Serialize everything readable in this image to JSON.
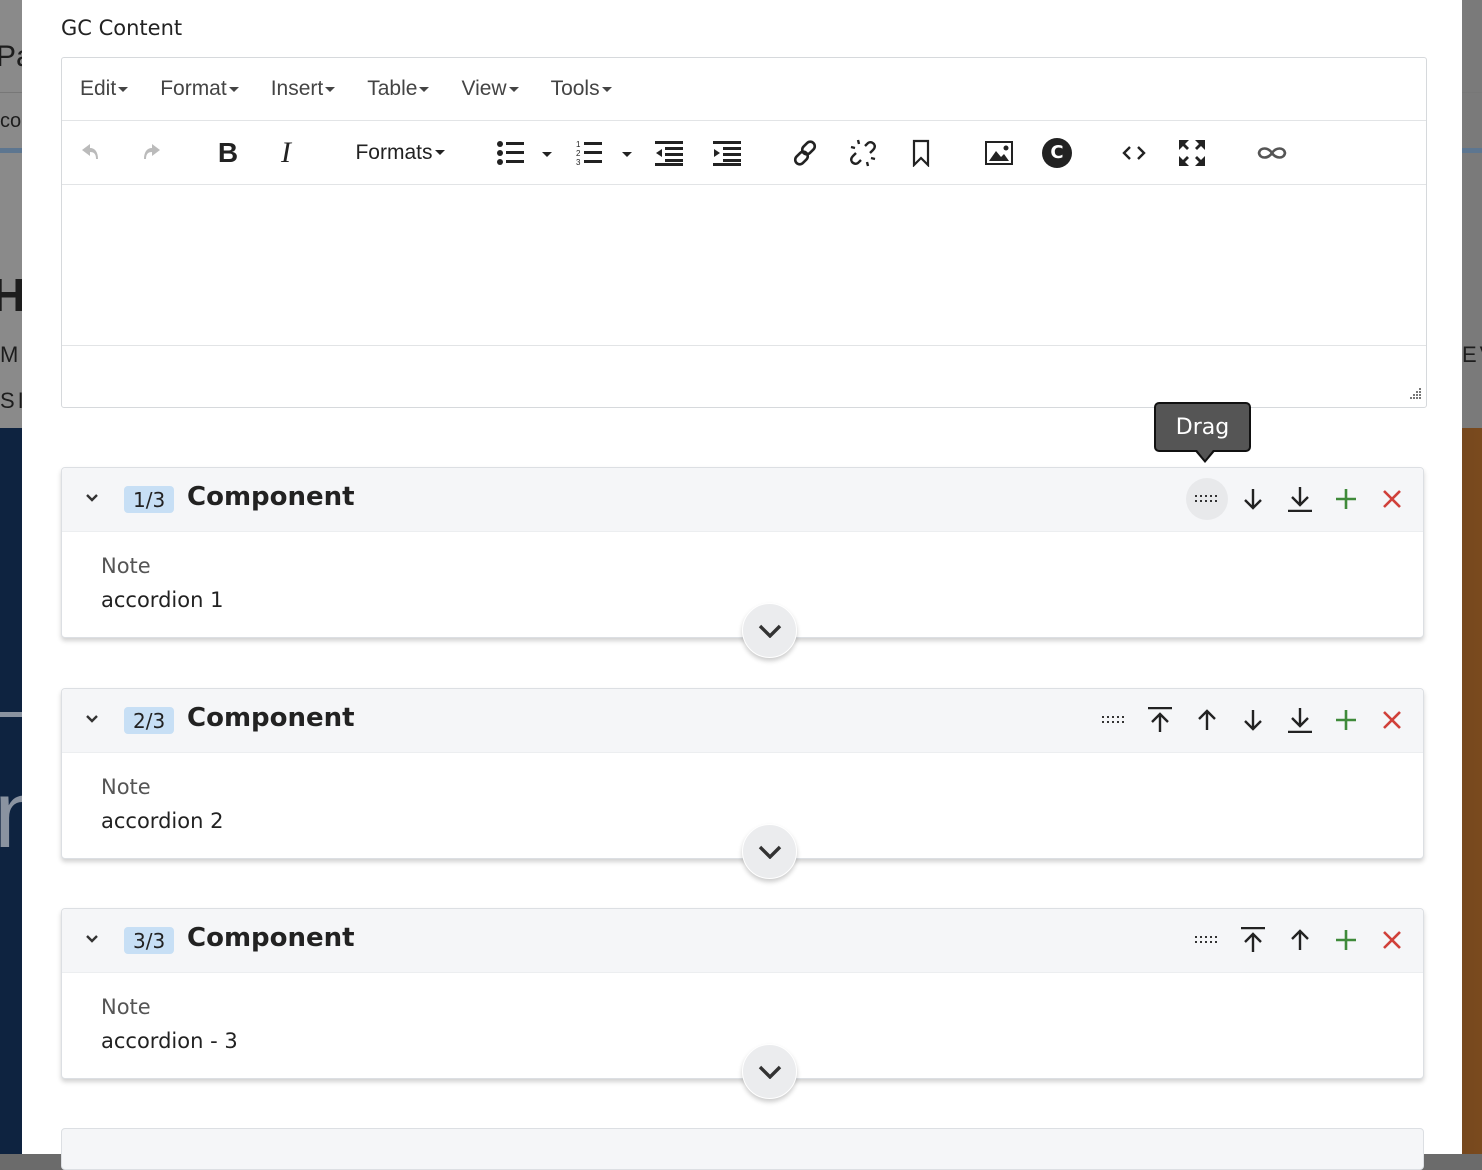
{
  "background": {
    "fragments": [
      "Pa",
      "co",
      "Hu",
      "M",
      "SI",
      "EV"
    ]
  },
  "field": {
    "label": "GC Content"
  },
  "editor": {
    "menus": [
      {
        "label": "Edit"
      },
      {
        "label": "Format"
      },
      {
        "label": "Insert"
      },
      {
        "label": "Table"
      },
      {
        "label": "View"
      },
      {
        "label": "Tools"
      }
    ],
    "toolbar": {
      "formats_label": "Formats",
      "buttons": [
        {
          "icon": "undo-icon",
          "enabled": false
        },
        {
          "icon": "redo-icon",
          "enabled": false
        },
        {
          "icon": "bold-icon"
        },
        {
          "icon": "italic-icon"
        },
        {
          "icon": "bullet-list-icon"
        },
        {
          "icon": "numbered-list-icon"
        },
        {
          "icon": "outdent-icon"
        },
        {
          "icon": "indent-icon"
        },
        {
          "icon": "link-icon"
        },
        {
          "icon": "unlink-icon"
        },
        {
          "icon": "bookmark-icon"
        },
        {
          "icon": "image-icon"
        },
        {
          "icon": "copyright-icon",
          "glyph": "C"
        },
        {
          "icon": "code-icon"
        },
        {
          "icon": "fullscreen-icon"
        },
        {
          "icon": "infinity-link-icon"
        }
      ]
    },
    "content": ""
  },
  "tooltip": {
    "text": "Drag"
  },
  "components": [
    {
      "badge": "1/3",
      "title": "Component",
      "note_label": "Note",
      "note_value": "accordion 1",
      "actions": [
        "drag",
        "move-down",
        "move-bottom",
        "add",
        "remove"
      ]
    },
    {
      "badge": "2/3",
      "title": "Component",
      "note_label": "Note",
      "note_value": "accordion 2",
      "actions": [
        "drag",
        "move-top",
        "move-up",
        "move-down",
        "move-bottom",
        "add",
        "remove"
      ]
    },
    {
      "badge": "3/3",
      "title": "Component",
      "note_label": "Note",
      "note_value": "accordion - 3",
      "actions": [
        "drag",
        "move-top",
        "move-up",
        "add",
        "remove"
      ]
    }
  ],
  "colors": {
    "badge_bg": "#c7dff5",
    "add_green": "#3f8a3a",
    "remove_red": "#d0403a",
    "tooltip_bg": "#555555",
    "header_bg": "#f5f6f8"
  }
}
